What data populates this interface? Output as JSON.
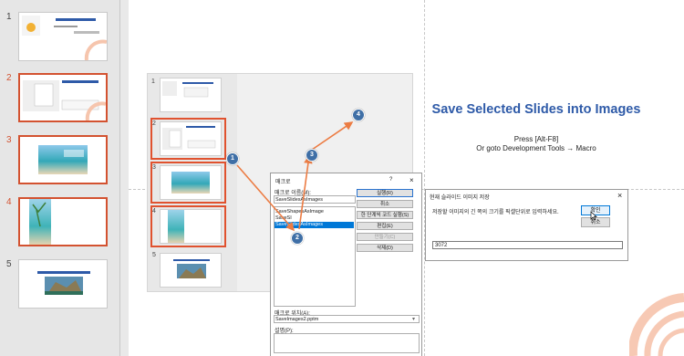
{
  "thumbnails": {
    "slides": [
      {
        "number": "1",
        "selected": false
      },
      {
        "number": "2",
        "selected": true
      },
      {
        "number": "3",
        "selected": true
      },
      {
        "number": "4",
        "selected": true
      },
      {
        "number": "5",
        "selected": false
      }
    ]
  },
  "slide": {
    "title": "Save Selected Slides into Images",
    "line1": "Press [Alt-F8]",
    "line2": "Or goto Development Tools → Macro"
  },
  "embedded": {
    "slide_numbers": [
      "1",
      "2",
      "3",
      "4",
      "5"
    ]
  },
  "macro_dialog": {
    "title": "매크로",
    "help_glyph": "?",
    "close_glyph": "×",
    "name_label": "매크로 이름(M):",
    "name_value": "SaveSlidesAsImages",
    "list": [
      "SaveShapesAsImage",
      "SaveSI",
      "SaveSlidesAsImages"
    ],
    "buttons": [
      {
        "label": "실행(R)",
        "enabled": true
      },
      {
        "label": "취소",
        "enabled": true
      },
      {
        "label": "한 단계씩 코드 실행(S)",
        "enabled": true
      },
      {
        "label": "편집(E)",
        "enabled": true
      },
      {
        "label": "만들기(C)",
        "enabled": false
      },
      {
        "label": "삭제(D)",
        "enabled": true
      }
    ],
    "location_label": "매크로 위치(A):",
    "location_value": "SaveImages2.pptm",
    "description_label": "설명(P):"
  },
  "size_dialog": {
    "title": "현재 슬라이드 이미지 저장",
    "close_glyph": "×",
    "prompt": "저장할 이미지의 긴 쪽의 크기를 픽셀단위로 입력하세요.",
    "ok_label": "확인",
    "cancel_label": "취소",
    "input_value": "3072"
  },
  "steps": [
    "1",
    "2",
    "3",
    "4"
  ],
  "colors": {
    "accent": "#d35230",
    "arrow": "#ec7c43",
    "badge": "#3f6fa6",
    "title": "#2e5aa8"
  }
}
